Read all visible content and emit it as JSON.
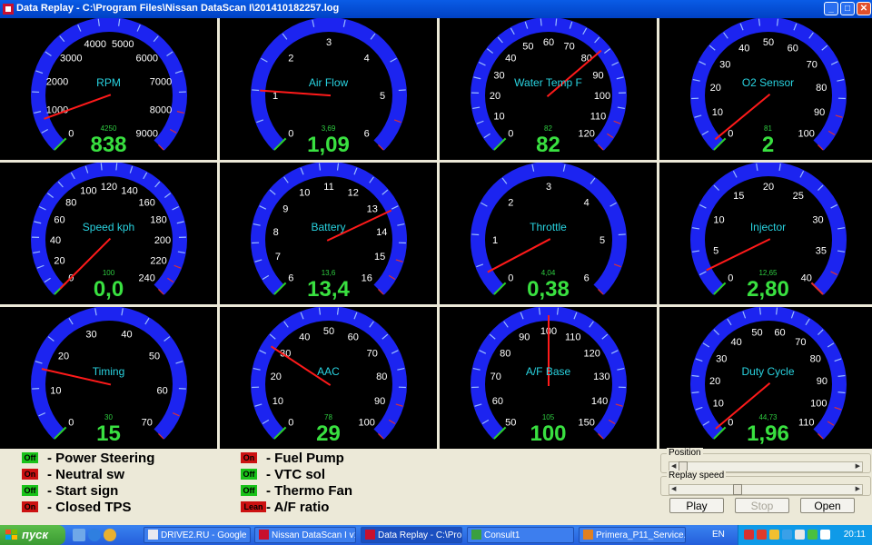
{
  "window": {
    "title": "Data Replay - C:\\Program Files\\Nissan DataScan I\\201410182257.log",
    "btn_min": "_",
    "btn_max": "□",
    "btn_close": "✕"
  },
  "colors": {
    "gauge_face": "#1c24f0",
    "needle": "#ff1a1a",
    "label": "#29d3e0",
    "value": "#39e040",
    "tick_green": "#2cd22c",
    "tick_red": "#e03030"
  },
  "gauges": [
    {
      "name": "RPM",
      "min": 0,
      "max": 9000,
      "value": 838,
      "display": "838",
      "small": "4250",
      "labels": [
        "0",
        "1000",
        "2000",
        "3000",
        "4000",
        "5000",
        "6000",
        "7000",
        "8000",
        "9000"
      ],
      "minors": 17
    },
    {
      "name": "Air Flow",
      "min": 0,
      "max": 6,
      "value": 1.09,
      "display": "1,09",
      "small": "3,69",
      "labels": [
        "0",
        "1",
        "2",
        "3",
        "4",
        "5",
        "6"
      ],
      "minors": 11
    },
    {
      "name": "Water Temp F",
      "min": 0,
      "max": 120,
      "value": 82,
      "display": "82",
      "small": "82",
      "labels": [
        "0",
        "10",
        "20",
        "30",
        "40",
        "50",
        "60",
        "70",
        "80",
        "90",
        "100",
        "110",
        "120"
      ],
      "minors": 23
    },
    {
      "name": "O2 Sensor",
      "min": 0,
      "max": 100,
      "value": 2,
      "display": "2",
      "small": "81",
      "labels": [
        "0",
        "10",
        "20",
        "30",
        "40",
        "50",
        "60",
        "70",
        "80",
        "90",
        "100"
      ],
      "minors": 19
    },
    {
      "name": "Speed kph",
      "min": 0,
      "max": 240,
      "value": 0,
      "display": "0,0",
      "small": "100",
      "labels": [
        "0",
        "20",
        "40",
        "60",
        "80",
        "100",
        "120",
        "140",
        "160",
        "180",
        "200",
        "220",
        "240"
      ],
      "minors": 23
    },
    {
      "name": "Battery",
      "min": 6,
      "max": 16,
      "value": 13.4,
      "display": "13,4",
      "small": "13,6",
      "labels": [
        "6",
        "7",
        "8",
        "9",
        "10",
        "11",
        "12",
        "13",
        "14",
        "15",
        "16"
      ],
      "minors": 19
    },
    {
      "name": "Throttle",
      "min": 0,
      "max": 6,
      "value": 0.38,
      "display": "0,38",
      "small": "4,04",
      "labels": [
        "0",
        "1",
        "2",
        "3",
        "4",
        "5",
        "6"
      ],
      "minors": 11
    },
    {
      "name": "Injector",
      "min": 0,
      "max": 40,
      "value": 2.8,
      "display": "2,80",
      "small": "12,65",
      "labels": [
        "0",
        "5",
        "10",
        "15",
        "20",
        "25",
        "30",
        "35",
        "40"
      ],
      "minors": 15
    },
    {
      "name": "Timing",
      "min": 0,
      "max": 70,
      "value": 15,
      "display": "15",
      "small": "30",
      "labels": [
        "0",
        "10",
        "20",
        "30",
        "40",
        "50",
        "60",
        "70"
      ],
      "minors": 13
    },
    {
      "name": "AAC",
      "min": 0,
      "max": 100,
      "value": 29,
      "display": "29",
      "small": "78",
      "labels": [
        "0",
        "10",
        "20",
        "30",
        "40",
        "50",
        "60",
        "70",
        "80",
        "90",
        "100"
      ],
      "minors": 19
    },
    {
      "name": "A/F Base",
      "min": 50,
      "max": 150,
      "value": 100,
      "display": "100",
      "small": "105",
      "labels": [
        "50",
        "60",
        "70",
        "80",
        "90",
        "100",
        "110",
        "120",
        "130",
        "140",
        "150"
      ],
      "minors": 19
    },
    {
      "name": "Duty Cycle",
      "min": 0,
      "max": 110,
      "value": 1.96,
      "display": "1,96",
      "small": "44,73",
      "labels": [
        "0",
        "10",
        "20",
        "30",
        "40",
        "50",
        "60",
        "70",
        "80",
        "90",
        "100",
        "110"
      ],
      "minors": 21
    }
  ],
  "indicators_left": [
    {
      "state": "Off",
      "label": "- Power Steering"
    },
    {
      "state": "On",
      "label": "- Neutral sw"
    },
    {
      "state": "Off",
      "label": "- Start sign"
    },
    {
      "state": "On",
      "label": "- Closed TPS"
    }
  ],
  "indicators_right": [
    {
      "state": "On",
      "label": "- Fuel Pump"
    },
    {
      "state": "Off",
      "label": "- VTC sol"
    },
    {
      "state": "Off",
      "label": "- Thermo Fan"
    },
    {
      "state": "Lean",
      "label": "- A/F ratio"
    }
  ],
  "controls": {
    "position_label": "Position",
    "position_value": 0.0,
    "speed_label": "Replay speed",
    "speed_value": 0.33,
    "play": "Play",
    "stop": "Stop",
    "open": "Open"
  },
  "taskbar": {
    "start": "пуск",
    "tasks": [
      "DRIVE2.RU - Google ...",
      "Nissan DataScan I v1...",
      "Data Replay - C:\\Pro...",
      "Consult1",
      "Primera_P11_Service..."
    ],
    "lang": "EN",
    "clock": "20:11"
  }
}
